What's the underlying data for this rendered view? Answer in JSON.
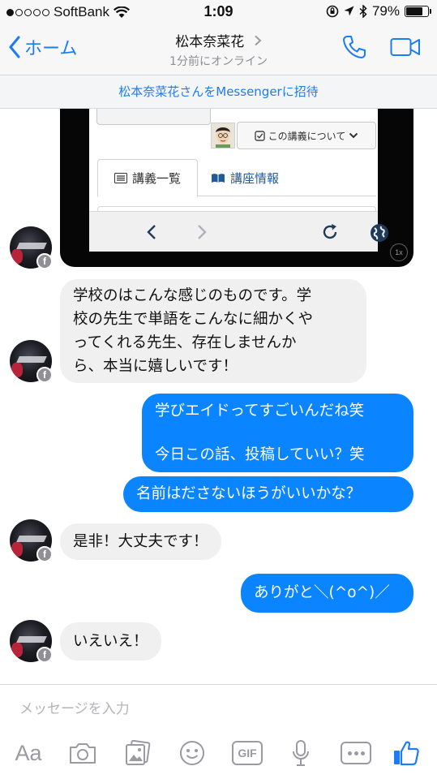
{
  "status_bar": {
    "carrier": "SoftBank",
    "time": "1:09",
    "battery_percent_label": "79%",
    "battery_level": 0.79
  },
  "header": {
    "back_label": "ホーム",
    "contact_name": "松本奈菜花",
    "contact_status": "1分前にオンライン"
  },
  "invite_banner": "松本奈菜花さんをMessengerに招待",
  "shared_screenshot": {
    "course_button": "この講義について",
    "tab_lectures": "講義一覧",
    "tab_course_info": "講座情報",
    "zoom_badge": "1x"
  },
  "messages": [
    {
      "from": "them",
      "text": "学校のはこんな感じのものです。学\n校の先生で単語をこんなに細かくや\nってくれる先生、存在しませんか\nら、本当に嬉しいです！"
    },
    {
      "from": "me",
      "text": "学びエイドってすごいんだね笑\n\n今日この話、投稿していい？笑"
    },
    {
      "from": "me",
      "text": "名前はださないほうがいいかな？"
    },
    {
      "from": "them",
      "text": "是非！大丈夫です！"
    },
    {
      "from": "me",
      "text": "ありがと＼(^o^)／"
    },
    {
      "from": "them",
      "text": "いえいえ！"
    }
  ],
  "composer": {
    "placeholder": "メッセージを入力",
    "text_format_label": "Aa",
    "gif_label": "GIF"
  },
  "colors": {
    "accent": "#1b7cf4",
    "outgoing_bubble": "#0a84ff",
    "incoming_bubble": "#f0f0f0"
  }
}
